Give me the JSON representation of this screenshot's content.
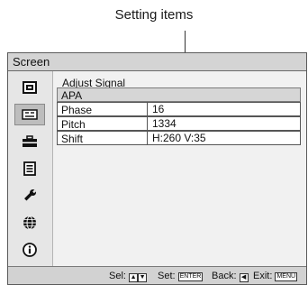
{
  "callout": {
    "label": "Setting items"
  },
  "window": {
    "title": "Screen"
  },
  "sidebar": {
    "items": [
      {
        "icon": "picture-icon",
        "active": false
      },
      {
        "icon": "screen-icon",
        "active": true
      },
      {
        "icon": "setup-toolbox-icon",
        "active": false
      },
      {
        "icon": "function-list-icon",
        "active": false
      },
      {
        "icon": "wrench-icon",
        "active": false
      },
      {
        "icon": "globe-icon",
        "active": false
      },
      {
        "icon": "info-icon",
        "active": false
      }
    ]
  },
  "main": {
    "section_title": "Adjust Signal",
    "rows": [
      {
        "label": "APA",
        "value": ""
      },
      {
        "label": "Phase",
        "value": "16"
      },
      {
        "label": "Pitch",
        "value": "1334"
      },
      {
        "label": "Shift",
        "value": "H:260 V:35"
      }
    ]
  },
  "footer": {
    "sel_label": "Sel:",
    "set_label": "Set:",
    "set_key": "ENTER",
    "back_label": "Back:",
    "exit_label": "Exit:",
    "exit_key": "MENU"
  }
}
